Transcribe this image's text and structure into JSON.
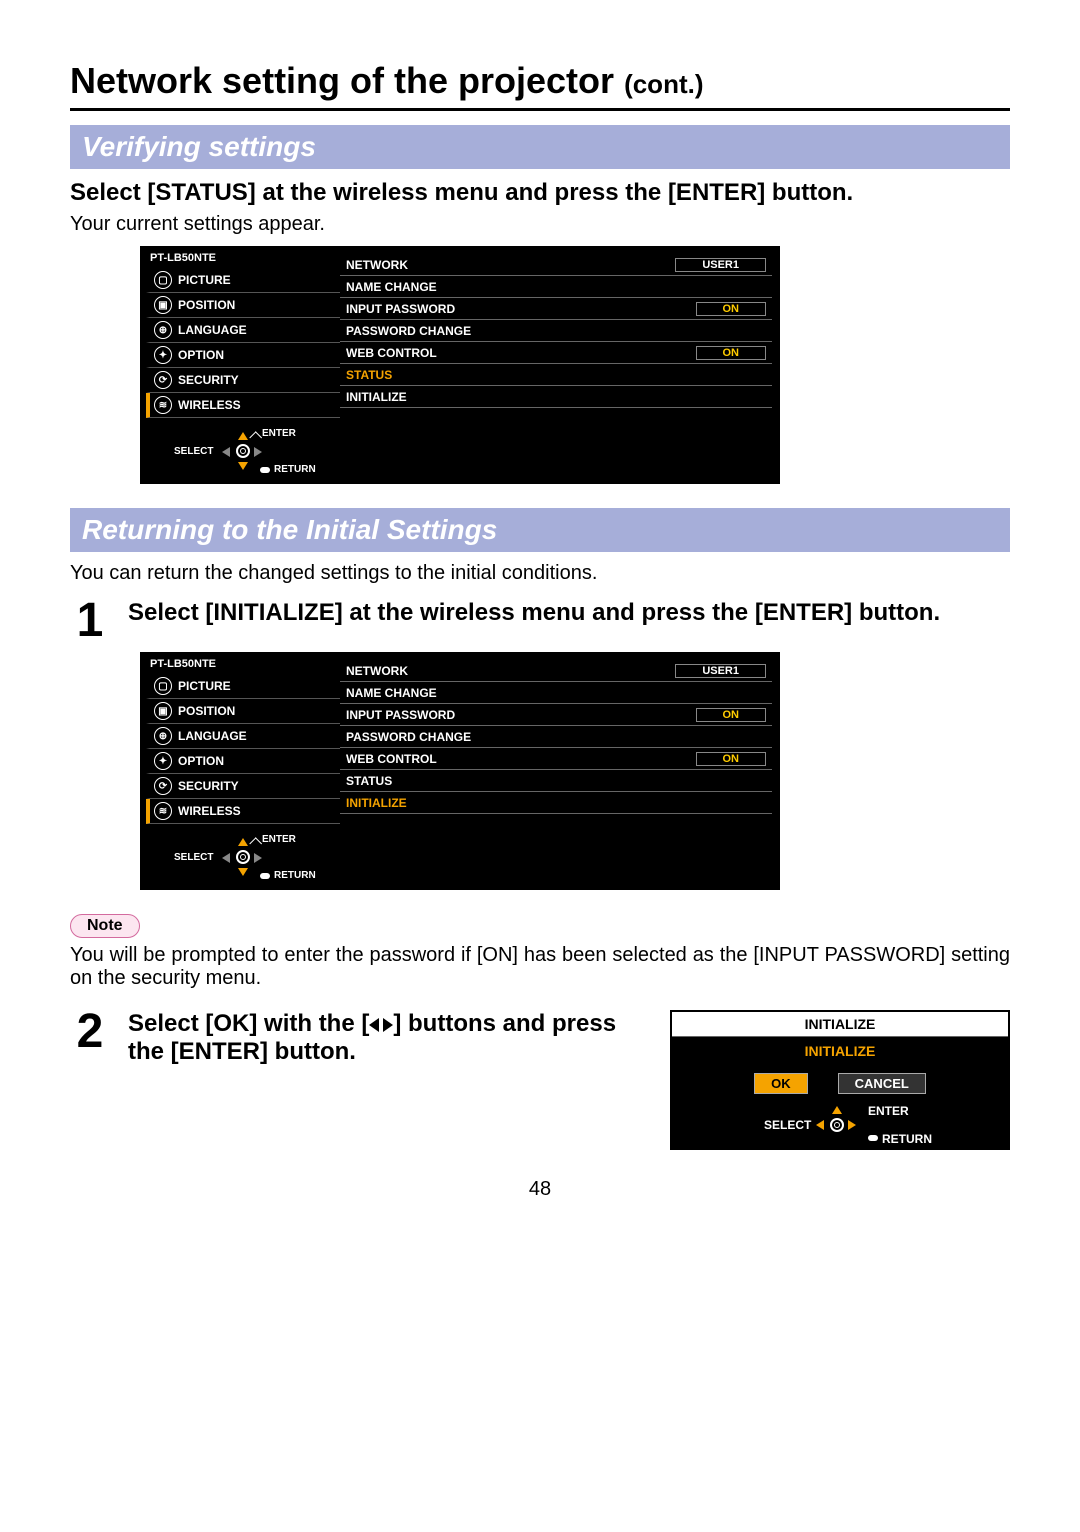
{
  "page_title_main": "Network setting of the projector",
  "page_title_cont": "(cont.)",
  "section1": {
    "header": "Verifying settings",
    "instruction": "Select [STATUS] at the wireless menu and press the [ENTER] button.",
    "sub": "Your current settings appear."
  },
  "section2": {
    "header": "Returning to the Initial Settings",
    "intro": "You can return the changed settings to the initial conditions."
  },
  "step1": {
    "num": "1",
    "text": "Select [INITIALIZE] at the wireless menu and press the [ENTER] button."
  },
  "note": {
    "label": "Note",
    "text": "You will be prompted to enter the password if [ON] has been selected as the [INPUT PASSWORD] setting on the security menu."
  },
  "step2": {
    "num": "2",
    "text_before": "Select [OK] with the [",
    "text_after": "] buttons and press the [ENTER] button."
  },
  "menu": {
    "model": "PT-LB50NTE",
    "left_items": [
      "PICTURE",
      "POSITION",
      "LANGUAGE",
      "OPTION",
      "SECURITY",
      "WIRELESS"
    ],
    "nav": {
      "select": "SELECT",
      "enter": "ENTER",
      "return": "RETURN"
    },
    "right_rows": [
      {
        "label": "NETWORK",
        "value": "USER1",
        "top": true
      },
      {
        "label": "NAME CHANGE"
      },
      {
        "label": "INPUT PASSWORD",
        "value": "ON"
      },
      {
        "label": "PASSWORD CHANGE"
      },
      {
        "label": "WEB CONTROL",
        "value": "ON"
      },
      {
        "label": "STATUS"
      },
      {
        "label": "INITIALIZE"
      }
    ]
  },
  "dialog": {
    "title": "INITIALIZE",
    "sub": "INITIALIZE",
    "ok": "OK",
    "cancel": "CANCEL",
    "nav": {
      "select": "SELECT",
      "enter": "ENTER",
      "return": "RETURN"
    }
  },
  "page_number": "48"
}
